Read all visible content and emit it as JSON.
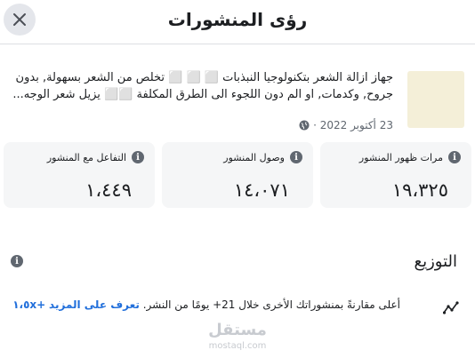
{
  "header": {
    "title": "رؤى المنشورات",
    "close_icon": "close-icon"
  },
  "post": {
    "text": "جهاز ازالة الشعر بتكنولوجيا النبذبات ⬜ ⬜ ⬜ تخلص من الشعر بسهولة, بدون جروح, وكدمات, او الم دون اللجوء الى الطرق المكلفة ⬜⬜ يزيل شعر الوجه...",
    "date": "23 أكتوبر 2022 ·"
  },
  "stats": [
    {
      "label": "مرات ظهور المنشور",
      "value": "١٩،٣٢٥"
    },
    {
      "label": "وصول المنشور",
      "value": "١٤،٠٧١"
    },
    {
      "label": "التفاعل مع المنشور",
      "value": "١،٤٤٩"
    }
  ],
  "distribution": {
    "title": "التوزيع",
    "text": "أعلى مقارنةً بمنشوراتك الأخرى خلال 21+ يومًا من النشر.",
    "badge": "+١،٥x",
    "link": "تعرف على المزيد"
  },
  "watermark": {
    "main": "مستقل",
    "sub": "mostaql.com"
  },
  "colors": {
    "link": "#216fdb",
    "card_bg": "#f5f6f7",
    "thumb": "#f4efd8"
  }
}
